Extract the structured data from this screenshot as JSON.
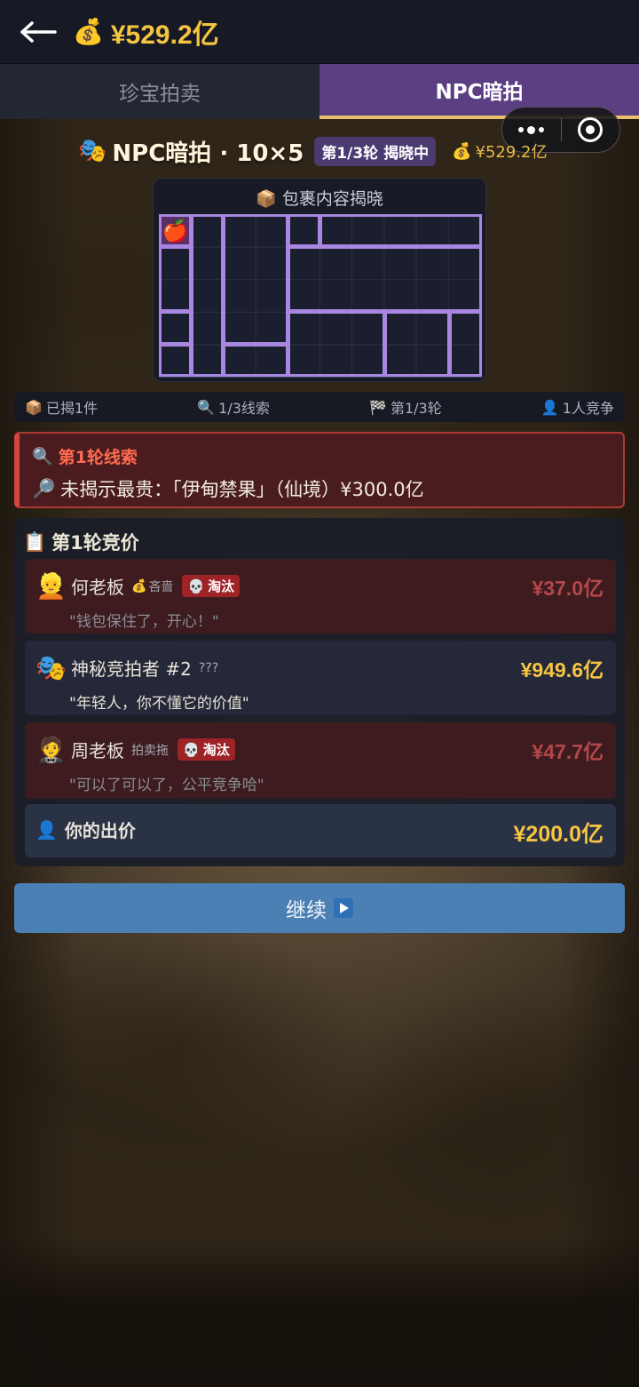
{
  "header": {
    "balance": "¥529.2亿",
    "money_icon": "money-bag-icon"
  },
  "tabs": [
    {
      "label": "珍宝拍卖",
      "active": false
    },
    {
      "label": "NPC暗拍",
      "active": true
    }
  ],
  "game": {
    "title": "NPC暗拍 · 10×5",
    "round_badge": "第1/3轮 揭晓中",
    "balance": "¥529.2亿"
  },
  "package": {
    "title": "包裹内容揭晓",
    "revealed_item_icon": "fruit-icon"
  },
  "stats": {
    "revealed": "已揭1件",
    "clues": "1/3线索",
    "round": "第1/3轮",
    "competitors": "1人竞争"
  },
  "clue": {
    "title": "第1轮线索",
    "text": "未揭示最贵：「伊甸禁果」（仙境）¥300.0亿"
  },
  "bids": {
    "title": "第1轮竞价",
    "rows": [
      {
        "avatar": "👱",
        "name": "何老板",
        "trait": "吝啬",
        "status": "淘汰",
        "amount": "¥37.0亿",
        "quote": "\"钱包保住了，开心！\""
      },
      {
        "avatar": "🎭",
        "name": "神秘竞拍者 #2",
        "trait": "???",
        "status": "",
        "amount": "¥949.6亿",
        "quote": "\"年轻人，你不懂它的价值\""
      },
      {
        "avatar": "🤵",
        "name": "周老板",
        "trait": "拍卖拖",
        "status": "淘汰",
        "amount": "¥47.7亿",
        "quote": "\"可以了可以了，公平竞争哈\""
      }
    ],
    "my_bid_label": "你的出价",
    "my_bid_amount": "¥200.0亿"
  },
  "continue_label": "继续"
}
